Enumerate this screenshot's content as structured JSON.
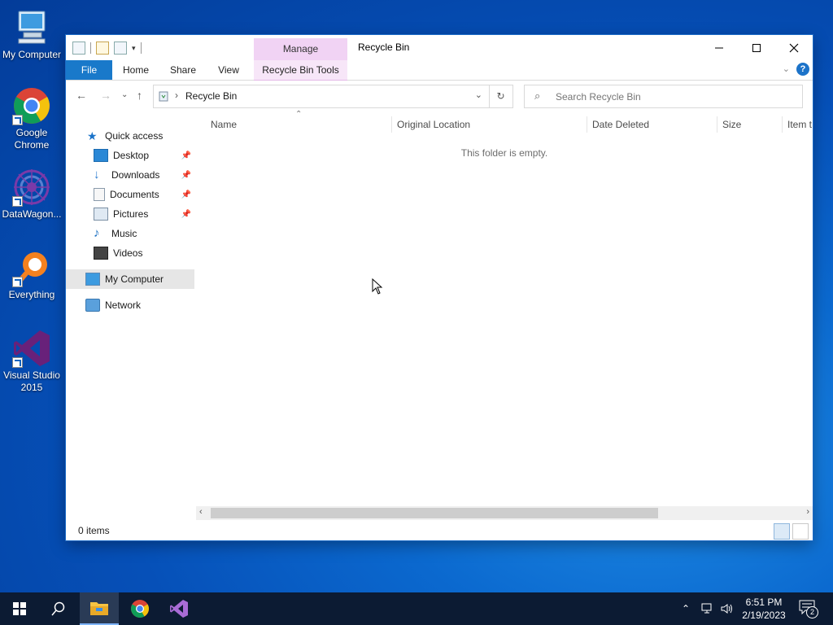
{
  "desktop": {
    "icons": [
      {
        "label": "My Computer"
      },
      {
        "label": "Google Chrome"
      },
      {
        "label": "DataWagon..."
      },
      {
        "label": "Everything"
      },
      {
        "label": "Visual Studio 2015"
      }
    ]
  },
  "window": {
    "title": "Recycle Bin",
    "context_tab": "Manage",
    "ribbon_tabs": [
      "File",
      "Home",
      "Share",
      "View",
      "Recycle Bin Tools"
    ],
    "address": {
      "breadcrumb": "Recycle Bin"
    },
    "search": {
      "placeholder": "Search Recycle Bin"
    },
    "nav_pane": {
      "quick_access": "Quick access",
      "items": [
        "Desktop",
        "Downloads",
        "Documents",
        "Pictures",
        "Music",
        "Videos"
      ],
      "my_computer": "My Computer",
      "network": "Network"
    },
    "columns": [
      "Name",
      "Original Location",
      "Date Deleted",
      "Size",
      "Item t"
    ],
    "empty_message": "This folder is empty.",
    "status": "0 items"
  },
  "taskbar": {
    "time": "6:51 PM",
    "date": "2/19/2023",
    "notification_count": "2"
  },
  "colors": {
    "file_tab": "#1979ca",
    "manage_tab": "#f1d3f4",
    "taskbar": "#0c1b33"
  }
}
